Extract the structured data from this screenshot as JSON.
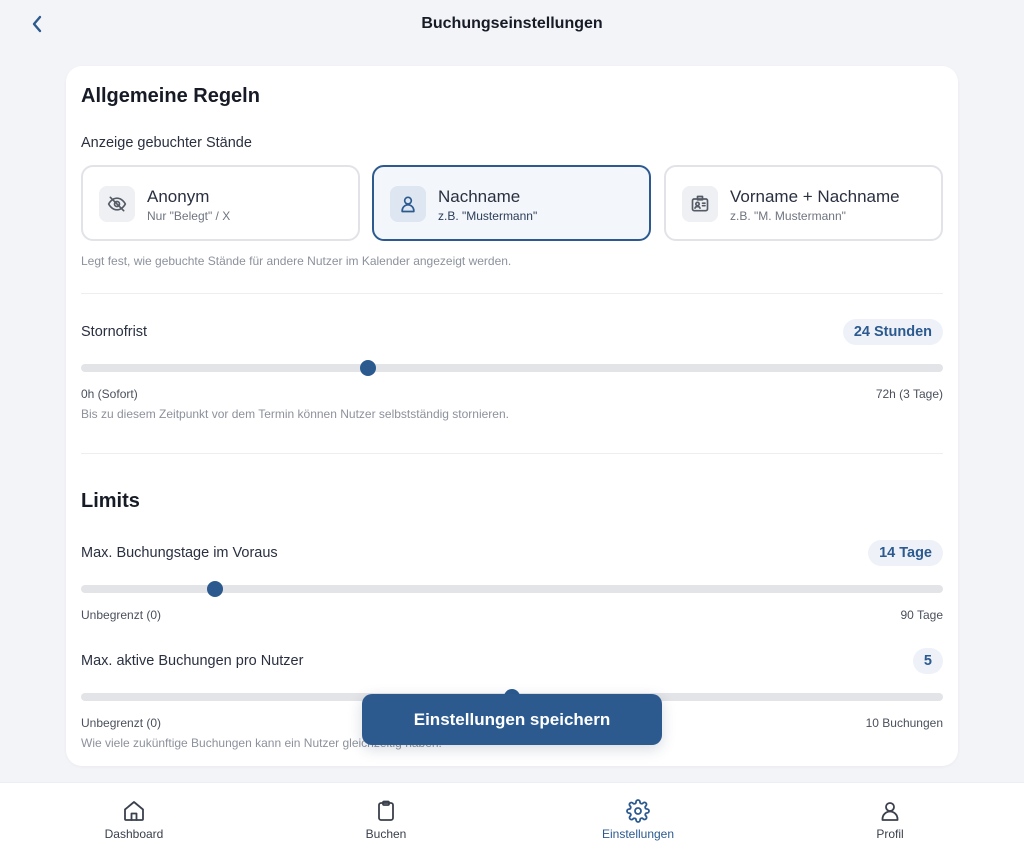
{
  "header": {
    "title": "Buchungseinstellungen",
    "back_icon": "chevron-left-icon"
  },
  "colors": {
    "accent": "#2c5a8f",
    "background": "#f3f4f7",
    "card": "#ffffff"
  },
  "general": {
    "title": "Allgemeine Regeln",
    "display_label": "Anzeige gebuchter Stände",
    "options": [
      {
        "icon": "eye-off-icon",
        "title": "Anonym",
        "subtitle": "Nur \"Belegt\" / X",
        "selected": false
      },
      {
        "icon": "user-icon",
        "title": "Nachname",
        "subtitle": "z.B. \"Mustermann\"",
        "selected": true
      },
      {
        "icon": "id-card-icon",
        "title": "Vorname + Nachname",
        "subtitle": "z.B. \"M. Mustermann\"",
        "selected": false
      }
    ],
    "display_hint": "Legt fest, wie gebuchte Stände für andere Nutzer im Kalender angezeigt werden."
  },
  "cancellation": {
    "label": "Stornofrist",
    "value_label": "24 Stunden",
    "value": 24,
    "min": 0,
    "max": 72,
    "min_label": "0h (Sofort)",
    "max_label": "72h (3 Tage)",
    "hint": "Bis zu diesem Zeitpunkt vor dem Termin können Nutzer selbstständig stornieren."
  },
  "limits": {
    "title": "Limits",
    "advance_days": {
      "label": "Max. Buchungstage im Voraus",
      "value_label": "14 Tage",
      "value": 14,
      "min": 0,
      "max": 90,
      "min_label": "Unbegrenzt (0)",
      "max_label": "90 Tage"
    },
    "active_bookings": {
      "label": "Max. aktive Buchungen pro Nutzer",
      "value_label": "5",
      "value": 5,
      "min": 0,
      "max": 10,
      "min_label": "Unbegrenzt (0)",
      "max_label": "10 Buchungen",
      "hint": "Wie viele zukünftige Buchungen kann ein Nutzer gleichzeitig haben."
    }
  },
  "save_button": "Einstellungen speichern",
  "nav": [
    {
      "icon": "home-icon",
      "label": "Dashboard",
      "active": false
    },
    {
      "icon": "clipboard-icon",
      "label": "Buchen",
      "active": false
    },
    {
      "icon": "gear-icon",
      "label": "Einstellungen",
      "active": true
    },
    {
      "icon": "user-icon",
      "label": "Profil",
      "active": false
    }
  ]
}
